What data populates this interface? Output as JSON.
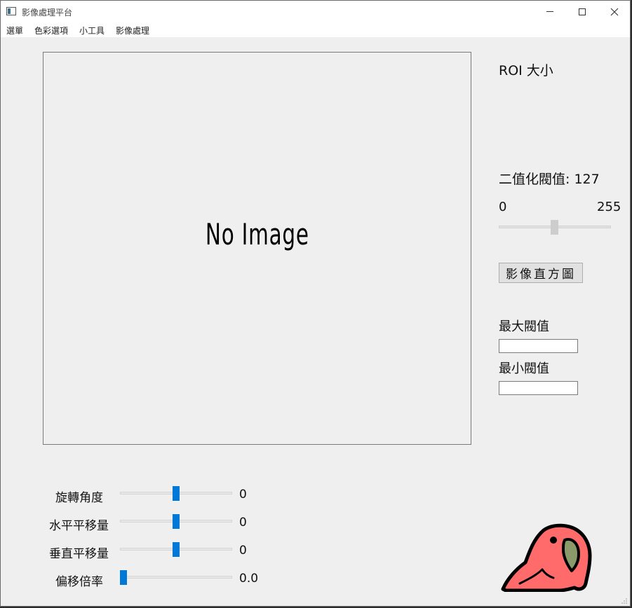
{
  "window": {
    "title": "影像處理平台"
  },
  "menubar": {
    "items": [
      {
        "label": "選單"
      },
      {
        "label": "色彩選項"
      },
      {
        "label": "小工具"
      },
      {
        "label": "影像處理"
      }
    ]
  },
  "image_panel": {
    "placeholder": "No Image"
  },
  "right_panel": {
    "roi_label": "ROI 大小",
    "threshold_label": "二值化閥值: 127",
    "threshold_min": "0",
    "threshold_max": "255",
    "threshold_value": 127,
    "histogram_button": "影像直方圖",
    "max_threshold_label": "最大閥值",
    "max_threshold_value": "",
    "min_threshold_label": "最小閥值",
    "min_threshold_value": ""
  },
  "sliders": [
    {
      "label": "旋轉角度",
      "value": "0"
    },
    {
      "label": "水平平移量",
      "value": "0"
    },
    {
      "label": "垂直平移量",
      "value": "0"
    },
    {
      "label": "偏移倍率",
      "value": "0.0"
    }
  ],
  "colors": {
    "slider_thumb": "#0078d7",
    "parrot_body": "#ff6b6b",
    "parrot_beak": "#8a9a6a"
  },
  "icons": {
    "app": "app-window-icon",
    "mascot": "party-parrot-icon"
  }
}
